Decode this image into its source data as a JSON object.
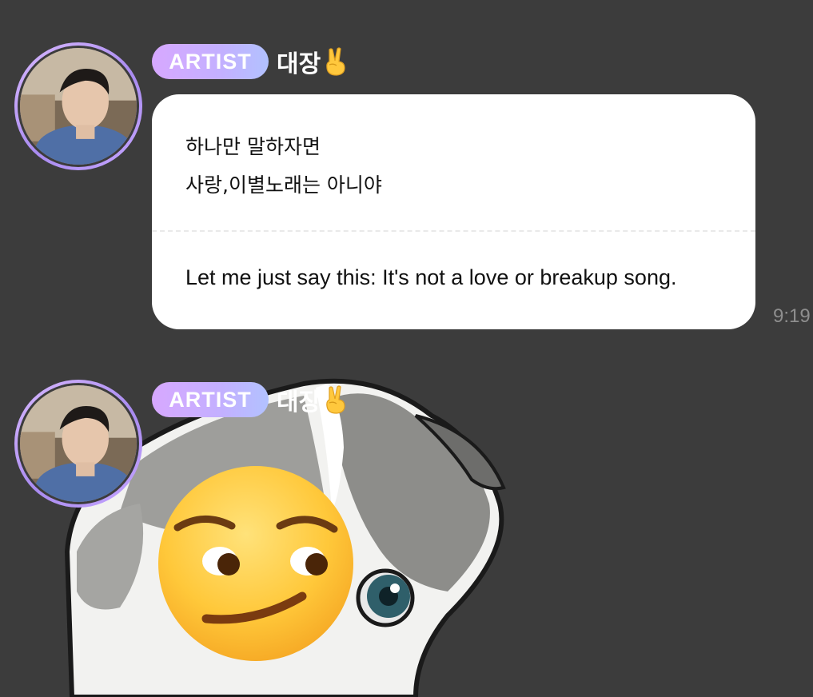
{
  "messages": [
    {
      "badge": "ARTIST",
      "sender": "대장",
      "sender_emoji": "victory-hand-emoji",
      "text_korean_line1": "하나만 말하자면",
      "text_korean_line2": "사랑,이별노래는 아니야",
      "text_english": "Let me just say this: It's not a love or breakup song.",
      "time": "9:19"
    },
    {
      "badge": "ARTIST",
      "sender": "대장",
      "sender_emoji": "victory-hand-emoji",
      "sticker": "smirking-cat-sticker"
    }
  ],
  "colors": {
    "background": "#3c3c3c",
    "bubble": "#ffffff",
    "badge_gradient_start": "#d7a8ff",
    "badge_gradient_end": "#b2c2ff",
    "timestamp": "#8e8e8e"
  }
}
